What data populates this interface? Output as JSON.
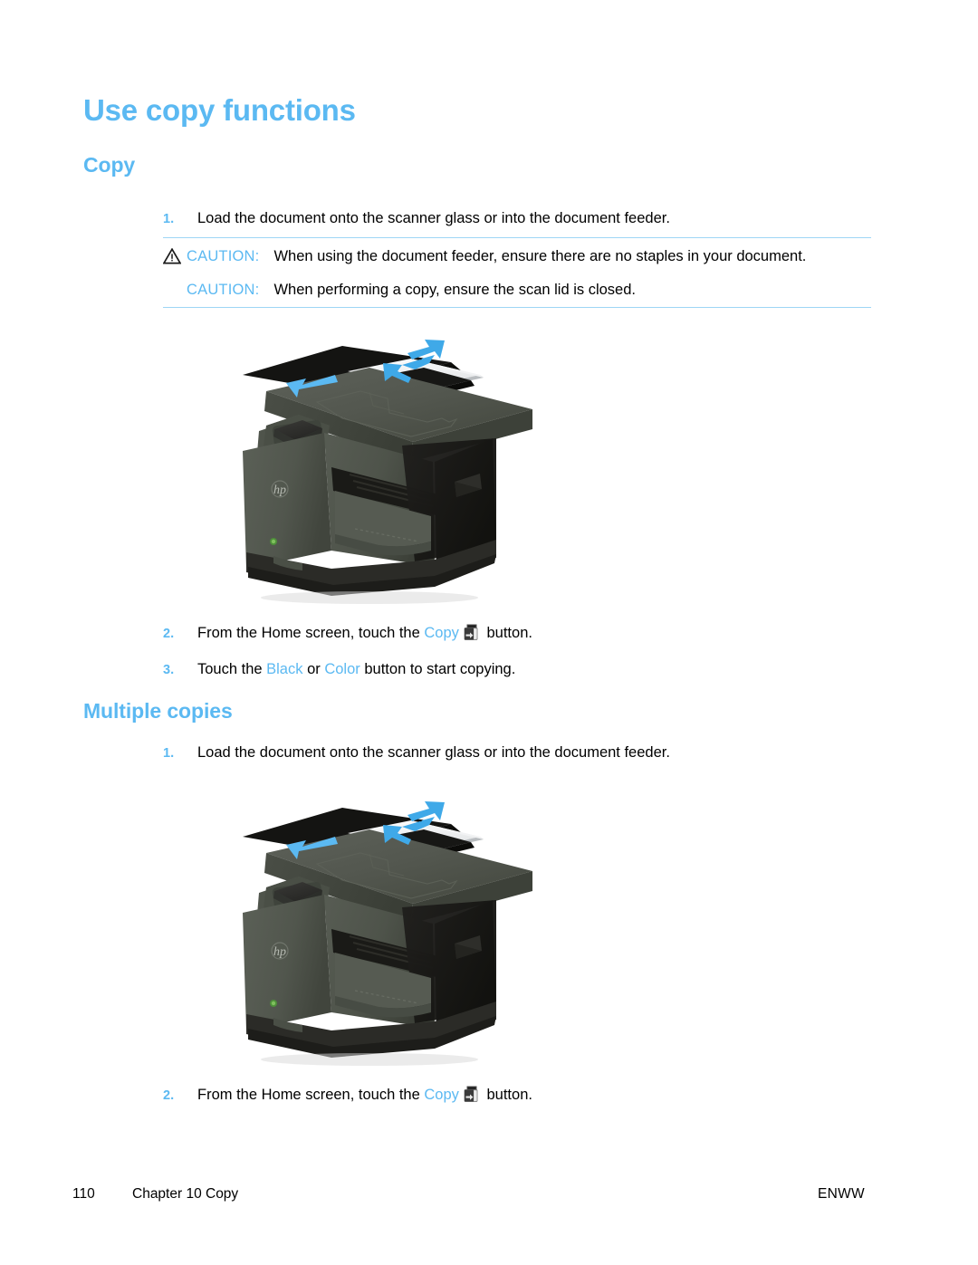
{
  "document": {
    "title": "Use copy functions",
    "accent_color": "#5bb9f2",
    "rule_color": "#9ed6f5",
    "text_color": "#000000"
  },
  "sections": [
    {
      "heading": "Copy",
      "steps": [
        {
          "number": "1.",
          "text": "Load the document onto the scanner glass or into the document feeder."
        },
        {
          "number": "2.",
          "text_before": "From the Home screen, touch the ",
          "link": "Copy",
          "icon": "copy-button-icon",
          "text_after": " button."
        },
        {
          "number": "3.",
          "text_before": "Touch the ",
          "link_1": "Black",
          "text_mid": " or ",
          "link_2": "Color",
          "text_after": " button to start copying."
        }
      ],
      "caution_block": {
        "rows": [
          {
            "icon": "warning-triangle-icon",
            "label": "CAUTION:",
            "text": "When using the document feeder, ensure there are no staples in your document."
          },
          {
            "icon": null,
            "label": "CAUTION:",
            "text": "When performing a copy, ensure the scan lid is closed."
          }
        ]
      },
      "illustration": "hp-officejet-pro-x-mfp-document-feeder"
    },
    {
      "heading": "Multiple copies",
      "steps": [
        {
          "number": "1.",
          "text": "Load the document onto the scanner glass or into the document feeder."
        },
        {
          "number": "2.",
          "text_before": "From the Home screen, touch the ",
          "link": "Copy",
          "icon": "copy-button-icon",
          "text_after": " button."
        }
      ],
      "illustration": "hp-officejet-pro-x-mfp-document-feeder"
    }
  ],
  "footer": {
    "page_number": "110",
    "chapter": "Chapter 10  Copy",
    "locale": "ENWW"
  }
}
